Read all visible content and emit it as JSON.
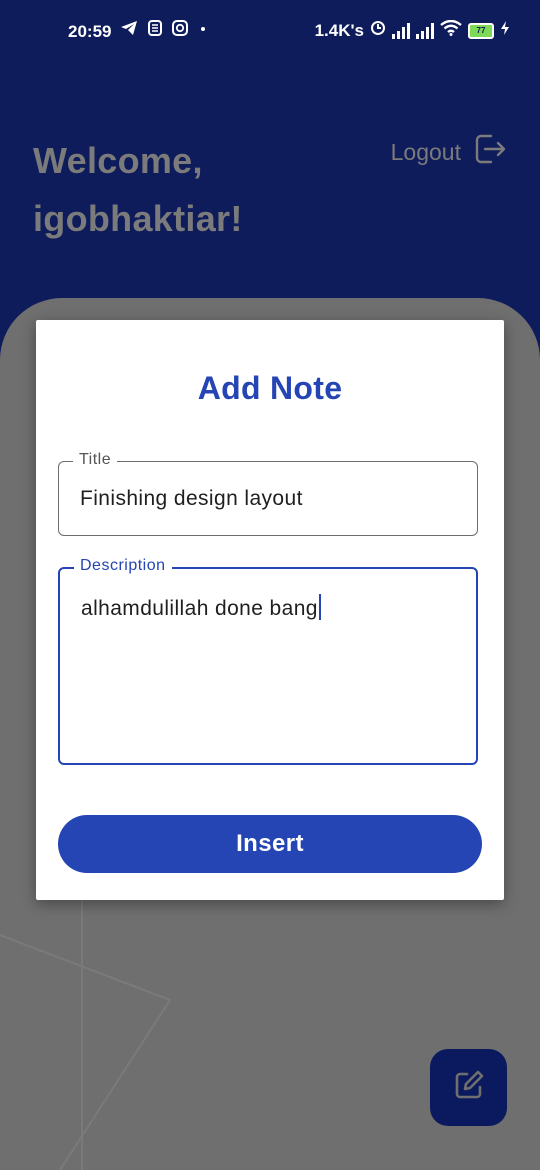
{
  "status_bar": {
    "time": "20:59",
    "network_speed": "1.4K's",
    "battery": "77",
    "left_icons": [
      "telegram-icon",
      "s-icon",
      "instagram-icon",
      "dot-icon"
    ],
    "right_icons": [
      "alarm-icon",
      "signal-icon",
      "signal-icon-2",
      "wifi-icon",
      "battery-icon",
      "charging-icon"
    ]
  },
  "header": {
    "welcome_line1": "Welcome,",
    "welcome_line2": "igobhaktiar!",
    "logout_label": "Logout",
    "color": "#0e1c5c"
  },
  "dialog": {
    "title": "Add Note",
    "title_field": {
      "label": "Title",
      "value": "Finishing design layout"
    },
    "description_field": {
      "label": "Description",
      "value": "alhamdulillah done bang"
    },
    "insert_label": "Insert",
    "accent_color": "#2445b3"
  },
  "fab": {
    "icon": "edit-icon",
    "color": "#0b1a5e"
  }
}
